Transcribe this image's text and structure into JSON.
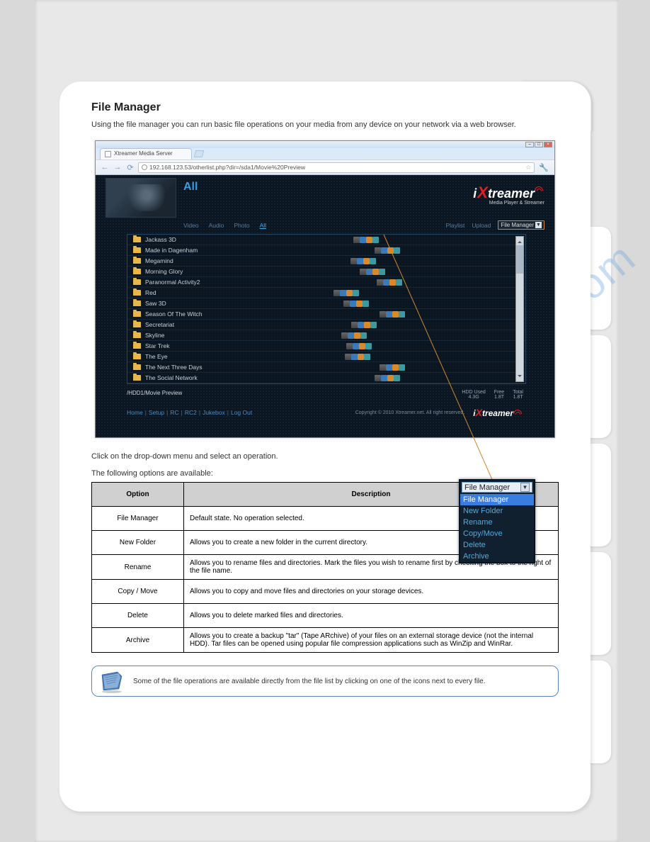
{
  "watermark": "manualshive.com",
  "section": {
    "title": "File Manager",
    "description_line1": "Using the file manager you can run basic file operations on your media from any device on your network via a web browser.",
    "description_line2": "Click on the drop-down menu and select an operation."
  },
  "browser": {
    "tab_title": "Xtreamer Media Server",
    "url": "192.168.123.53/otherlist.php?dir=/sda1/Movie%20Preview"
  },
  "app": {
    "category_title": "All",
    "nav": {
      "video": "Video",
      "audio": "Audio",
      "photo": "Photo",
      "all": "All",
      "playlist": "Playlist",
      "upload": "Upload"
    },
    "fm_label": "File Manager",
    "brand": "treamer",
    "tagline": "Media Player & Streamer",
    "files": [
      "Jackass 3D",
      "Made in Dagenham",
      "Megamind",
      "Morning Glory",
      "Paranormal Activity2",
      "Red",
      "Saw 3D",
      "Season Of The Witch",
      "Secretariat",
      "Skyline",
      "Star Trek",
      "The Eye",
      "The Next Three Days",
      "The Social Network"
    ],
    "path": "/HDD1/Movie Preview",
    "hdd": {
      "used_label": "HDD Used",
      "used_value": "4.3G",
      "free_label": "Free",
      "free_value": "1.8T",
      "total_label": "Total",
      "total_value": "1.8T"
    },
    "links": [
      "Home",
      "Setup",
      "RC",
      "RC2",
      "Jukebox",
      "Log Out"
    ],
    "copyright": "Copyright © 2010 Xtreamer.net. All right reserved."
  },
  "popup": {
    "selected": "File Manager",
    "items": [
      "File Manager",
      "New Folder",
      "Rename",
      "Copy/Move",
      "Delete",
      "Archive"
    ]
  },
  "options_intro": "The following options are available:",
  "table": {
    "head_option": "Option",
    "head_desc": "Description",
    "rows": [
      {
        "option": "File Manager",
        "desc": "Default state. No operation selected."
      },
      {
        "option": "New Folder",
        "desc": "Allows you to create a new folder in the current directory."
      },
      {
        "option": "Rename",
        "desc": "Allows you to rename files and directories. Mark the files you wish to rename first by checking the box to the right of the file name."
      },
      {
        "option": "Copy / Move",
        "desc": "Allows you to copy and move files and directories on your storage devices."
      },
      {
        "option": "Delete",
        "desc": "Allows you to delete marked files and directories."
      },
      {
        "option": "Archive",
        "desc": "Allows you to create a backup \"tar\" (Tape ARchive) of your files on an external storage device (not the internal HDD). Tar files can be opened using popular file compression applications such as WinZip and WinRar."
      }
    ]
  },
  "note": "Some of the file operations are available directly from the file list by clicking on one of the icons next to every file."
}
